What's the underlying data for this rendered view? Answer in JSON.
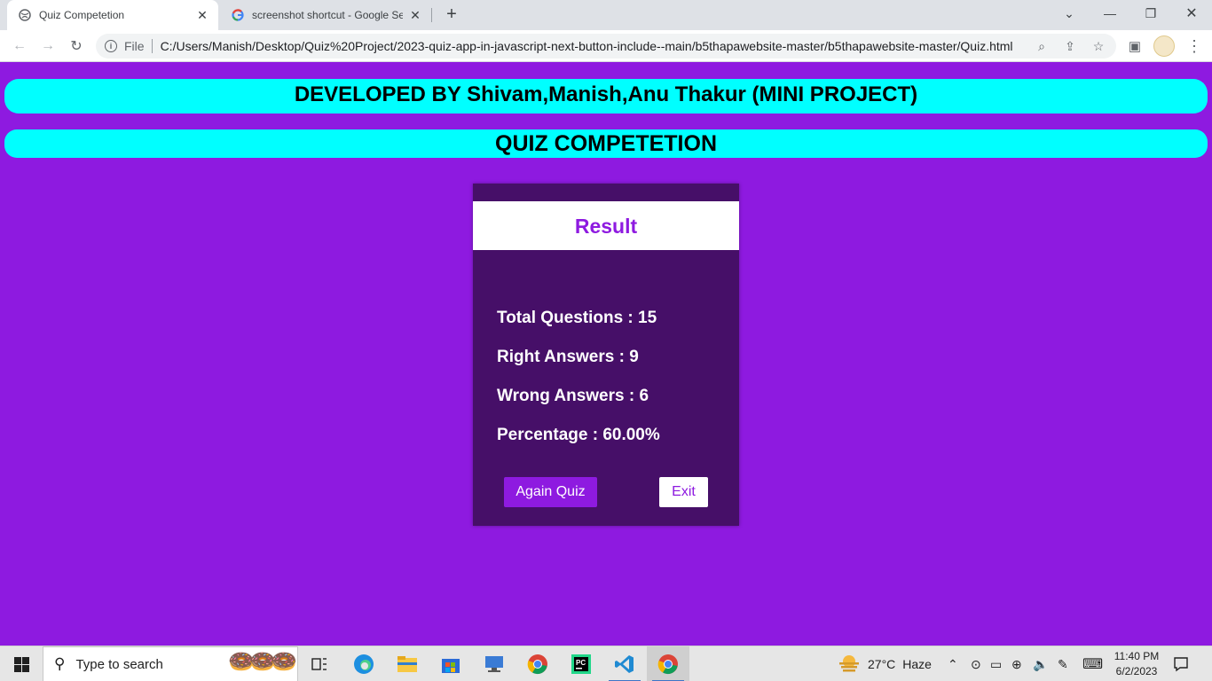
{
  "browser": {
    "tabs": [
      {
        "title": "Quiz Competetion",
        "active": true
      },
      {
        "title": "screenshot shortcut - Google Sea",
        "active": false
      }
    ],
    "omnibox": {
      "scheme_label": "File",
      "url": "C:/Users/Manish/Desktop/Quiz%20Project/2023-quiz-app-in-javascript-next-button-include--main/b5thapawebsite-master/b5thapawebsite-master/Quiz.html"
    }
  },
  "page": {
    "developer_banner": "DEVELOPED BY Shivam,Manish,Anu Thakur (MINI PROJECT)",
    "title_banner": "QUIZ COMPETETION",
    "result": {
      "heading": "Result",
      "total_questions": "Total Questions : 15",
      "right_answers": "Right Answers : 9",
      "wrong_answers": "Wrong Answers : 6",
      "percentage": "Percentage : 60.00%",
      "again_button": "Again Quiz",
      "exit_button": "Exit"
    }
  },
  "taskbar": {
    "search_placeholder": "Type to search",
    "weather_temp": "27°C",
    "weather_text": "Haze",
    "time": "11:40 PM",
    "date": "6/2/2023"
  },
  "colors": {
    "page_background": "#8e1ae0",
    "banner": "#00ffff",
    "result_box": "#460f68"
  }
}
